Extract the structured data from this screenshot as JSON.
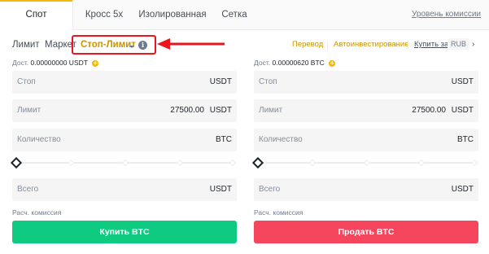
{
  "tabs": [
    {
      "label": "Спот"
    },
    {
      "label": "Кросс 5x"
    },
    {
      "label": "Изолированная"
    },
    {
      "label": "Сетка"
    }
  ],
  "fee_level_link": "Уровень комиссии",
  "order_types": {
    "limit": "Лимит",
    "market": "Маркет",
    "stop_limit": "Стоп-Лимит"
  },
  "links": {
    "transfer": "Перевод",
    "auto_invest": "Автоинвестирование",
    "buy_with": "Купить за",
    "currency": "RUB"
  },
  "buy": {
    "available_label": "Дост.",
    "available_value": "0.00000000 USDT",
    "stop": {
      "label": "Стоп",
      "value": "",
      "unit": "USDT"
    },
    "limit": {
      "label": "Лимит",
      "value": "27500.00",
      "unit": "USDT"
    },
    "amount": {
      "label": "Количество",
      "value": "",
      "unit": "BTC"
    },
    "slider_percent": 0,
    "total": {
      "label": "Всего",
      "value": "",
      "unit": "USDT"
    },
    "fee_label": "Расч. комиссия",
    "button": "Купить BTC"
  },
  "sell": {
    "available_label": "Дост.",
    "available_value": "0.00000620 BTC",
    "stop": {
      "label": "Стоп",
      "value": "",
      "unit": "USDT"
    },
    "limit": {
      "label": "Лимит",
      "value": "27500.00",
      "unit": "USDT"
    },
    "amount": {
      "label": "Количество",
      "value": "",
      "unit": "BTC"
    },
    "slider_percent": 0,
    "total": {
      "label": "Всего",
      "value": "",
      "unit": "USDT"
    },
    "fee_label": "Расч. комиссия",
    "button": "Продать BTC"
  },
  "colors": {
    "accent": "#f0b90b",
    "buy": "#0ecb81",
    "sell": "#f6465d",
    "highlight": "#e8161e"
  },
  "icons": [
    "info-icon",
    "plus-circle-icon",
    "chevron-down-icon",
    "chevron-right-icon",
    "slider-handle-icon",
    "annotation-arrow-icon"
  ]
}
